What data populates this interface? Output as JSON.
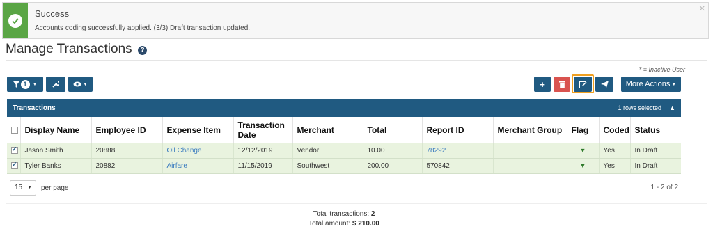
{
  "alert": {
    "title": "Success",
    "message": "Accounts coding successfully applied. (3/3) Draft transaction updated.",
    "close": "×",
    "color": "#5aa545"
  },
  "page": {
    "title": "Manage Transactions",
    "help": "?",
    "inactive_note": "* = Inactive User"
  },
  "toolbar": {
    "filter_count": "1",
    "more_actions_label": "More Actions",
    "accent": "#205a81"
  },
  "panel": {
    "title": "Transactions",
    "rows_selected": "1 rows selected"
  },
  "table": {
    "headers": [
      "Display Name",
      "Employee ID",
      "Expense Item",
      "Transaction Date",
      "Merchant",
      "Total",
      "Report ID",
      "Merchant Group",
      "Flag",
      "Coded",
      "Status"
    ],
    "rows": [
      {
        "display_name": "Jason Smith",
        "employee_id": "20888",
        "expense_item": "Oil Change",
        "transaction_date": "12/12/2019",
        "merchant": "Vendor",
        "total": "10.00",
        "report_id": "78292",
        "merchant_group": "",
        "flag": "flag-icon",
        "coded": "Yes",
        "status": "In Draft"
      },
      {
        "display_name": "Tyler Banks",
        "employee_id": "20882",
        "expense_item": "Airfare",
        "transaction_date": "11/15/2019",
        "merchant": "Southwest",
        "total": "200.00",
        "report_id": "570842",
        "merchant_group": "",
        "flag": "flag-icon",
        "coded": "Yes",
        "status": "In Draft"
      }
    ]
  },
  "pagination": {
    "per_page_value": "15",
    "per_page_label": "per page",
    "range": "1 - 2 of 2"
  },
  "totals": {
    "transactions_label": "Total transactions: ",
    "transactions_value": "2",
    "amount_label": "Total amount: ",
    "amount_value": "$ 210.00"
  }
}
